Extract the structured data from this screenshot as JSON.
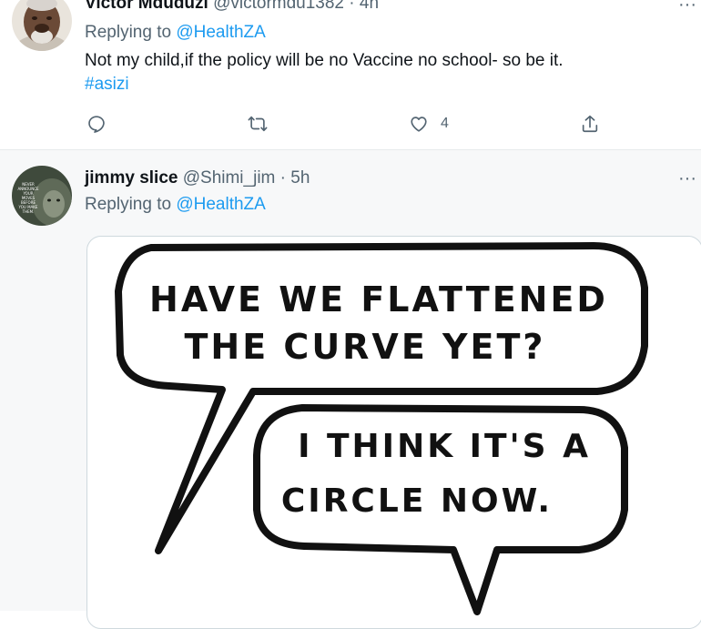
{
  "tweets": [
    {
      "name": "Victor Mduduzi",
      "handle": "@victormdu1382",
      "separator": "·",
      "time": "4h",
      "replying_prefix": "Replying to",
      "replying_to": "@HealthZA",
      "text": "Not my child,if the policy will be no Vaccine no school- so be it.",
      "hashtag": "#asizi",
      "more_label": "···",
      "actions": {
        "reply_icon": "reply-icon",
        "retweet_icon": "retweet-icon",
        "like_icon": "heart-icon",
        "like_count": "4",
        "share_icon": "share-icon"
      }
    },
    {
      "name": "jimmy slice",
      "handle": "@Shimi_jim",
      "separator": "·",
      "time": "5h",
      "replying_prefix": "Replying to",
      "replying_to": "@HealthZA",
      "more_label": "···",
      "avatar_text": "NEVER ANNOUNCE YOUR MOVES BEFORE YOU MAKE THEM.",
      "comic": {
        "bubble1_line1": "HAVE WE FLATTENED",
        "bubble1_line2": "THE CURVE YET?",
        "bubble2_line1": "I THINK IT'S A",
        "bubble2_line2": "CIRCLE NOW."
      }
    }
  ],
  "colors": {
    "accent": "#1d9bf0",
    "muted": "#536471",
    "text": "#0f1419"
  }
}
